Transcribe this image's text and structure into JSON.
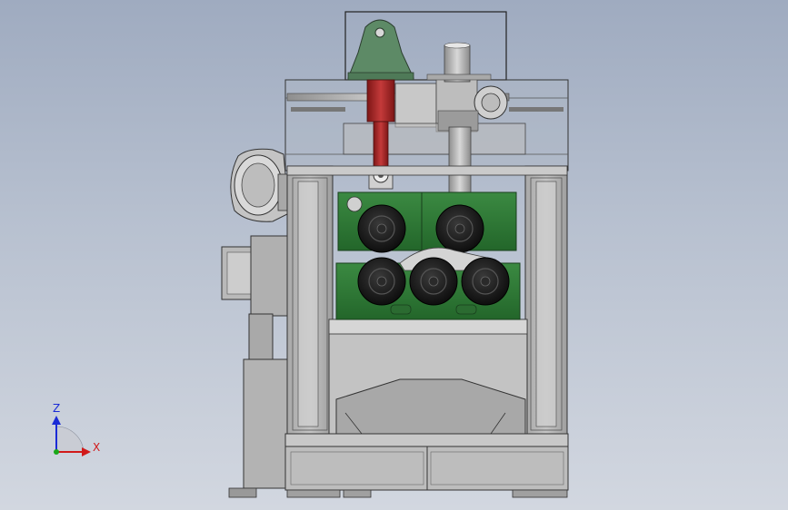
{
  "viewport": {
    "background_top": "#9fabc0",
    "background_bottom": "#d2d7e0"
  },
  "model": {
    "description_colors": {
      "frame": "#b4b4b4",
      "frame_line": "#333333",
      "roller_housing": "#2e7a35",
      "gearbox": "#5a8a6a",
      "hydraulic_cylinder": "#b02a2a",
      "roller_core": "#1c1c1c"
    },
    "upper_rollers": 2,
    "lower_rollers": 3
  },
  "triad": {
    "z_label": "Z",
    "x_label": "X",
    "z_color": "#1a2bd6",
    "x_color": "#d11a1a",
    "y_color": "#1aa81a"
  }
}
